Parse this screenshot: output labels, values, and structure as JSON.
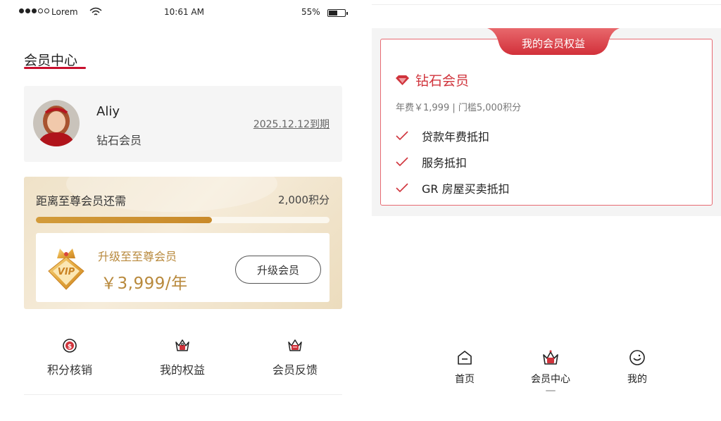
{
  "status_bar": {
    "carrier": "Lorem",
    "time": "10:61 AM",
    "battery_percent": "55%",
    "battery_level": 0.55
  },
  "page": {
    "title": "会员中心"
  },
  "profile": {
    "name": "Aliy",
    "level": "钻石会员",
    "expire": "2025.12.12到期"
  },
  "upgrade": {
    "label": "距离至尊会员还需",
    "points_needed": "2,000积分",
    "progress_fraction": 0.6,
    "title": "升级至至尊会员",
    "price": "￥3,999/年",
    "button_label": "升级会员"
  },
  "quick_actions": [
    {
      "label": "积分核销",
      "icon": "points-coin-icon"
    },
    {
      "label": "我的权益",
      "icon": "crown-gift-icon"
    },
    {
      "label": "会员反馈",
      "icon": "crown-feedback-icon"
    }
  ],
  "benefits": {
    "tab_title": "我的会员权益",
    "level": "钻石会员",
    "fee_text": "年费￥1,999 | 门槛5,000积分",
    "items": [
      "贷款年费抵扣",
      "服务抵扣",
      "GR 房屋买卖抵扣"
    ]
  },
  "tabbar": {
    "items": [
      {
        "label": "首页",
        "icon": "home-icon"
      },
      {
        "label": "会员中心",
        "icon": "crown-icon",
        "active": true
      },
      {
        "label": "我的",
        "icon": "smile-icon"
      }
    ]
  },
  "colors": {
    "accent_red": "#c8102e",
    "gold": "#b8893c",
    "benefit_border": "#e76a72"
  }
}
